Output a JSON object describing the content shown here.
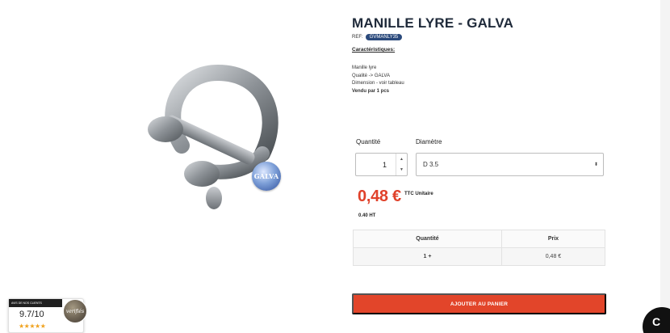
{
  "product": {
    "title": "MANILLE LYRE - GALVA",
    "ref_label": "REF:",
    "ref_value": "GVMANLY35",
    "carac_title": "Caractéristiques:",
    "carac_lines": [
      "Manille lyre",
      "Qualité -> GALVA",
      "Dimension - voir tableau"
    ],
    "sold_by": "Vendu par 1 pcs",
    "badge_text": "GALVA"
  },
  "form": {
    "quantity_label": "Quantité",
    "quantity_value": "1",
    "diameter_label": "Diamètre",
    "diameter_value": "D 3.5"
  },
  "price": {
    "ttc": "0,48 €",
    "ttc_note": "TTC Unitaire",
    "ht": "0.40 HT"
  },
  "price_table": {
    "headers": [
      "Quantité",
      "Prix"
    ],
    "rows": [
      [
        "1 +",
        "0,48 €"
      ]
    ]
  },
  "cart": {
    "label": "AJOUTER AU PANIER"
  },
  "rating": {
    "banner": "AVIS DE NOS CLIENTS",
    "score": "9.7/10",
    "stars": "★★★★★",
    "seal_text": "verifiés"
  },
  "chat": {
    "glyph": "C"
  },
  "colors": {
    "accent": "#e2452a",
    "price": "#e0412a",
    "ref_badge": "#2b4a7c"
  },
  "icons": [
    "spinner-up-icon",
    "spinner-down-icon",
    "select-arrows-icon",
    "chat-icon"
  ]
}
